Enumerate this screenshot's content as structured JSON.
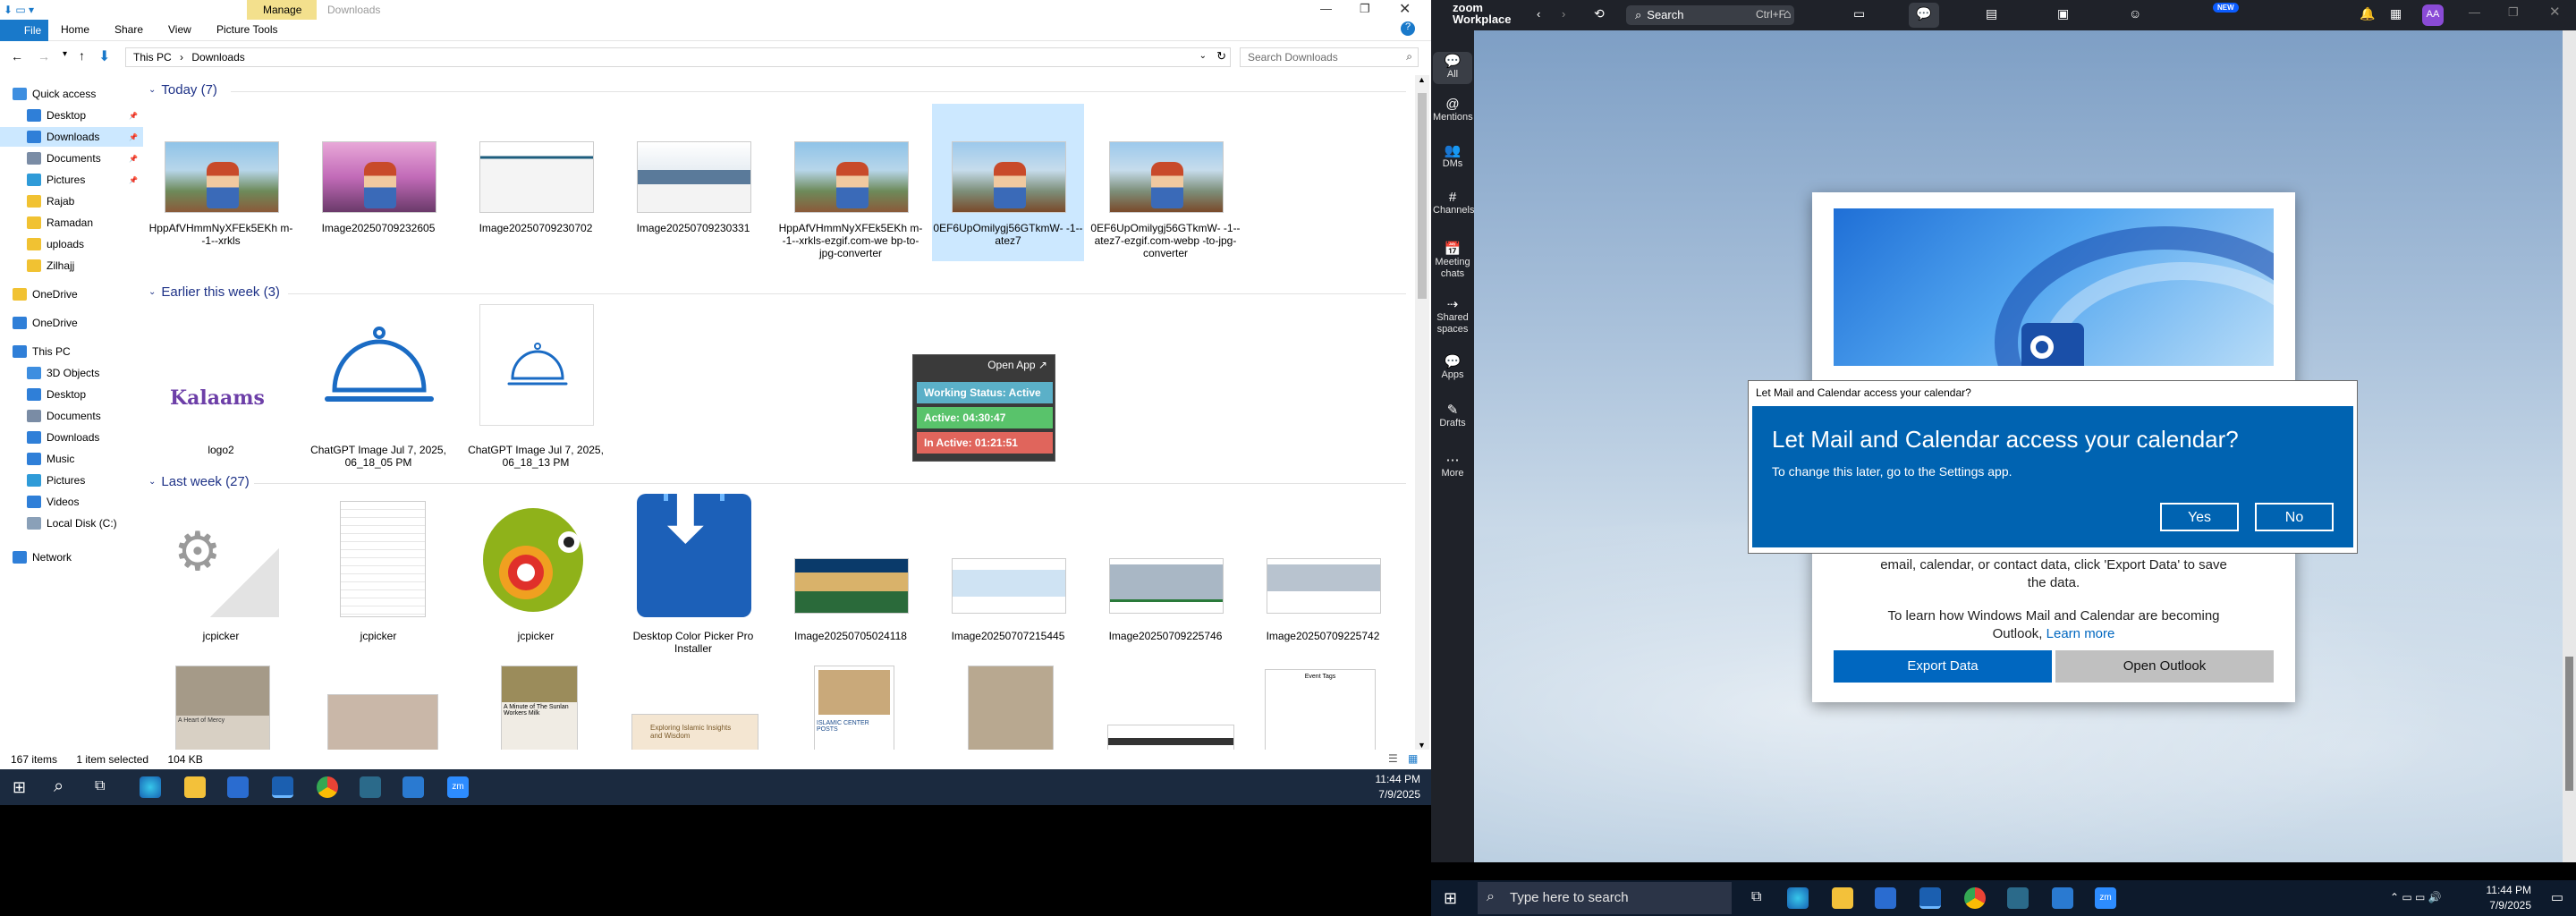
{
  "explorer": {
    "ribbon": {
      "file": "File",
      "home": "Home",
      "share": "Share",
      "view": "View",
      "manage": "Manage",
      "picture_tools": "Picture Tools",
      "title": "Downloads"
    },
    "address": {
      "this_pc": "This PC",
      "current": "Downloads",
      "search_placeholder": "Search Downloads"
    },
    "nav": {
      "items": [
        {
          "label": "Quick access",
          "icon": "star-icon",
          "color": "#3d8ee0"
        },
        {
          "label": "Desktop",
          "icon": "desktop-icon",
          "color": "#2f7fd8"
        },
        {
          "label": "Downloads",
          "icon": "download-icon",
          "color": "#2f7fd8"
        },
        {
          "label": "Documents",
          "icon": "documents-icon",
          "color": "#7a8ca5"
        },
        {
          "label": "Pictures",
          "icon": "pictures-icon",
          "color": "#2f9bd8"
        },
        {
          "label": "Rajab",
          "icon": "folder-icon",
          "color": "#f1c232"
        },
        {
          "label": "Ramadan",
          "icon": "folder-icon",
          "color": "#f1c232"
        },
        {
          "label": "uploads",
          "icon": "folder-icon",
          "color": "#f1c232"
        },
        {
          "label": "Zilhajj",
          "icon": "folder-icon",
          "color": "#f1c232"
        },
        {
          "label": "OneDrive",
          "icon": "folder-icon",
          "color": "#f1c232"
        },
        {
          "label": "OneDrive",
          "icon": "cloud-icon",
          "color": "#2f7fd8"
        },
        {
          "label": "This PC",
          "icon": "pc-icon",
          "color": "#2f7fd8"
        },
        {
          "label": "3D Objects",
          "icon": "cube-icon",
          "color": "#3d8ee0"
        },
        {
          "label": "Desktop",
          "icon": "desktop-icon",
          "color": "#2f7fd8"
        },
        {
          "label": "Documents",
          "icon": "documents-icon",
          "color": "#7a8ca5"
        },
        {
          "label": "Downloads",
          "icon": "download-icon",
          "color": "#2f7fd8"
        },
        {
          "label": "Music",
          "icon": "music-icon",
          "color": "#2f7fd8"
        },
        {
          "label": "Pictures",
          "icon": "pictures-icon",
          "color": "#2f9bd8"
        },
        {
          "label": "Videos",
          "icon": "videos-icon",
          "color": "#2f7fd8"
        },
        {
          "label": "Local Disk (C:)",
          "icon": "disk-icon",
          "color": "#8aa0b8"
        },
        {
          "label": "Network",
          "icon": "network-icon",
          "color": "#2f7fd8"
        }
      ]
    },
    "groups": {
      "today": "Today (7)",
      "earlier": "Earlier this week (3)",
      "last_week": "Last week (27)"
    },
    "today_files": [
      {
        "name": "HppAfVHmmNyXFEk5EKh m--1--xrkls"
      },
      {
        "name": "Image20250709232605"
      },
      {
        "name": "Image20250709230702"
      },
      {
        "name": "Image20250709230331"
      },
      {
        "name": "HppAfVHmmNyXFEk5EKh m--1--xrkls-ezgif.com-we bp-to-jpg-converter"
      },
      {
        "name": "0EF6UpOmilygj56GTkmW- -1--atez7"
      },
      {
        "name": "0EF6UpOmilygj56GTkmW- -1--atez7-ezgif.com-webp -to-jpg-converter"
      }
    ],
    "earlier_files": [
      {
        "name": "logo2",
        "logo_text": "Kalaams"
      },
      {
        "name": "ChatGPT Image Jul 7, 2025, 06_18_05 PM"
      },
      {
        "name": "ChatGPT Image Jul 7, 2025, 06_18_13 PM"
      }
    ],
    "last_week_files": [
      {
        "name": "jcpicker"
      },
      {
        "name": "jcpicker"
      },
      {
        "name": "jcpicker"
      },
      {
        "name": "Desktop Color Picker Pro Installer"
      },
      {
        "name": "Image20250705024118"
      },
      {
        "name": "Image20250707215445"
      },
      {
        "name": "Image20250709225746"
      },
      {
        "name": "Image20250709225742"
      }
    ],
    "partial_thumb_texts": [
      "A Minute of The Sunlan Workers Milk",
      "Exploring Islamic Insights and Wisdom",
      "ISLAMIC CENTER POSTS",
      "Event Tags"
    ],
    "status": {
      "count": "167 items",
      "selected": "1 item selected",
      "size": "104 KB"
    },
    "work_status": {
      "open_app": "Open App ↗",
      "status": "Working Status: Active",
      "active": "Active: 04:30:47",
      "inactive": "In Active: 01:21:51"
    }
  },
  "taskbar_left": {
    "time": "11:44 PM",
    "date": "7/9/2025"
  },
  "zoom": {
    "logo_top": "zoom",
    "logo_bottom": "Workplace",
    "search_label": "Search",
    "search_shortcut": "Ctrl+F",
    "new_badge": "NEW",
    "avatar": "AA",
    "sidebar": [
      {
        "label": "All",
        "glyph": "💬"
      },
      {
        "label": "Mentions",
        "glyph": "@"
      },
      {
        "label": "DMs",
        "glyph": "👥"
      },
      {
        "label": "Channels",
        "glyph": "#"
      },
      {
        "label": "Meeting chats",
        "glyph": "📅"
      },
      {
        "label": "Shared spaces",
        "glyph": "⇢"
      },
      {
        "label": "Apps",
        "glyph": "💬"
      },
      {
        "label": "Drafts",
        "glyph": "✎"
      },
      {
        "label": "More",
        "glyph": "⋯"
      }
    ],
    "outlook_card": {
      "text1": "time when you open Mail and Calendar. If you have local email, calendar, or contact data, click 'Export Data' to save the data.",
      "text2": "To learn how Windows Mail and Calendar are becoming Outlook,",
      "learn_more": "Learn more",
      "export_btn": "Export Data",
      "open_btn": "Open Outlook"
    },
    "dialog": {
      "title": "Let Mail and Calendar access your calendar?",
      "heading": "Let Mail and Calendar access your calendar?",
      "body": "To change this later, go to the Settings app.",
      "yes": "Yes",
      "no": "No"
    }
  },
  "taskbar_right": {
    "search_placeholder": "Type here to search",
    "time": "11:44 PM",
    "date": "7/9/2025"
  }
}
